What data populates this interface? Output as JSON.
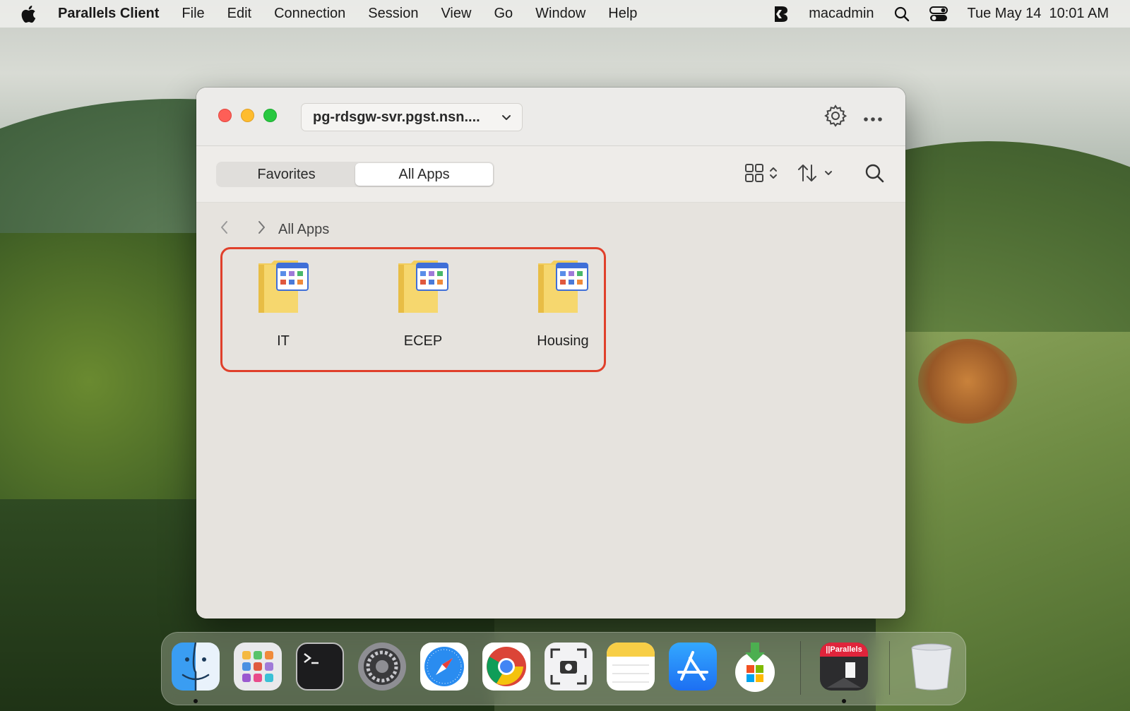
{
  "menubar": {
    "app_name": "Parallels Client",
    "menus": [
      "File",
      "Edit",
      "Connection",
      "Session",
      "View",
      "Go",
      "Window",
      "Help"
    ],
    "user": "macadmin",
    "datetime": "Tue May 14  10:01 AM"
  },
  "window": {
    "server": "pg-rdsgw-svr.pgst.nsn....",
    "tabs": [
      {
        "label": "Favorites",
        "active": false
      },
      {
        "label": "All Apps",
        "active": true
      }
    ],
    "breadcrumb": "All Apps",
    "folders": [
      {
        "name": "IT"
      },
      {
        "name": "ECEP"
      },
      {
        "name": "Housing"
      }
    ]
  },
  "dock": {
    "apps": [
      "finder-icon",
      "launchpad-icon",
      "terminal-icon",
      "system-settings-icon",
      "safari-icon",
      "chrome-icon",
      "screenshot-icon",
      "notes-icon",
      "app-store-icon",
      "windows-app-installer-icon",
      "parallels-client-icon",
      "trash-icon"
    ],
    "parallels_label": "||Parallels"
  },
  "colors": {
    "selection_outline": "#e0402b",
    "close": "#fe5f57",
    "minimize": "#febc2e",
    "zoom": "#28c840"
  }
}
